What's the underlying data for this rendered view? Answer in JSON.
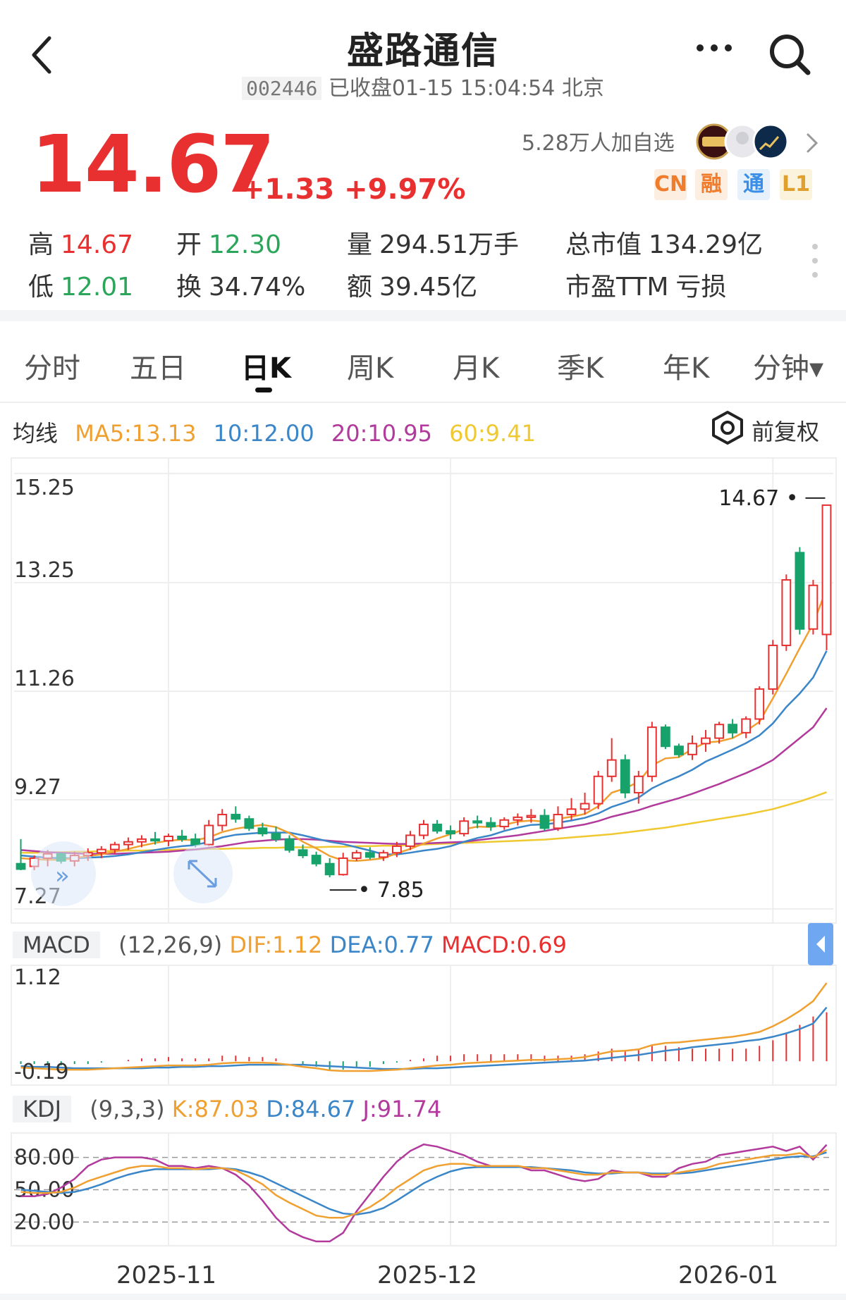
{
  "header": {
    "title": "盛路通信",
    "code": "002446",
    "status": "已收盘01-15 15:04:54 北京"
  },
  "quote": {
    "price": "14.67",
    "change": "+1.33 +9.97%",
    "watchers": "5.28万人加自选",
    "tags": [
      "CN",
      "融",
      "通",
      "L1"
    ],
    "stats": {
      "high_label": "高",
      "high": "14.67",
      "low_label": "低",
      "low": "12.01",
      "open_label": "开",
      "open": "12.30",
      "turnover_label": "换",
      "turnover": "34.74%",
      "volume_label": "量",
      "volume": "294.51万手",
      "amount_label": "额",
      "amount": "39.45亿",
      "mcap_label": "总市值",
      "mcap": "134.29亿",
      "pe_label": "市盈TTM",
      "pe": "亏损"
    }
  },
  "tabs": [
    "分时",
    "五日",
    "日K",
    "周K",
    "月K",
    "季K",
    "年K",
    "分钟▾"
  ],
  "active_tab": "日K",
  "ma": {
    "label": "均线",
    "ma5": "MA5:13.13",
    "ma10": "10:12.00",
    "ma20": "20:10.95",
    "ma60": "60:9.41",
    "adjust": "前复权"
  },
  "macd_header": {
    "label": "MACD",
    "params": "(12,26,9)",
    "dif": "DIF:1.12",
    "dea": "DEA:0.77",
    "macd": "MACD:0.69"
  },
  "kdj_header": {
    "label": "KDJ",
    "params": "(9,3,3)",
    "k": "K:87.03",
    "d": "D:84.67",
    "j": "J:91.74"
  },
  "colors": {
    "up": "#e93030",
    "down": "#16a26a",
    "ma5": "#f0a030",
    "ma10": "#3a86c8",
    "ma20": "#b13a9c",
    "ma60": "#f0c830",
    "dif": "#f0a030",
    "dea": "#3a86c8"
  },
  "chart_data": {
    "type": "candlestick",
    "x_labels": [
      "2025-11",
      "2025-12",
      "2026-01"
    ],
    "x_label_index": [
      11,
      32,
      56
    ],
    "price_axis": {
      "ticks": [
        "15.25",
        "13.25",
        "11.26",
        "9.27",
        "7.27"
      ],
      "ylim": [
        7.27,
        15.25
      ]
    },
    "max_marker": "14.67",
    "min_marker": "7.85",
    "ohlc": [
      [
        8.1,
        8.55,
        7.98,
        8.0
      ],
      [
        8.05,
        8.25,
        7.98,
        8.2
      ],
      [
        8.2,
        8.35,
        8.05,
        8.28
      ],
      [
        8.28,
        8.3,
        8.1,
        8.15
      ],
      [
        8.15,
        8.32,
        8.05,
        8.25
      ],
      [
        8.25,
        8.38,
        8.15,
        8.3
      ],
      [
        8.3,
        8.42,
        8.2,
        8.36
      ],
      [
        8.36,
        8.5,
        8.28,
        8.45
      ],
      [
        8.45,
        8.58,
        8.35,
        8.5
      ],
      [
        8.5,
        8.62,
        8.4,
        8.55
      ],
      [
        8.55,
        8.68,
        8.45,
        8.52
      ],
      [
        8.52,
        8.65,
        8.42,
        8.6
      ],
      [
        8.6,
        8.72,
        8.5,
        8.55
      ],
      [
        8.55,
        8.65,
        8.4,
        8.45
      ],
      [
        8.45,
        8.9,
        8.42,
        8.8
      ],
      [
        8.8,
        9.1,
        8.7,
        9.0
      ],
      [
        9.0,
        9.15,
        8.85,
        8.92
      ],
      [
        8.92,
        8.98,
        8.7,
        8.75
      ],
      [
        8.75,
        8.85,
        8.6,
        8.65
      ],
      [
        8.65,
        8.78,
        8.5,
        8.55
      ],
      [
        8.55,
        8.62,
        8.3,
        8.35
      ],
      [
        8.35,
        8.45,
        8.2,
        8.25
      ],
      [
        8.25,
        8.32,
        8.05,
        8.1
      ],
      [
        8.1,
        8.2,
        7.85,
        7.9
      ],
      [
        7.9,
        8.3,
        7.88,
        8.2
      ],
      [
        8.2,
        8.35,
        8.15,
        8.3
      ],
      [
        8.3,
        8.4,
        8.18,
        8.22
      ],
      [
        8.22,
        8.35,
        8.15,
        8.3
      ],
      [
        8.3,
        8.5,
        8.22,
        8.42
      ],
      [
        8.42,
        8.7,
        8.35,
        8.62
      ],
      [
        8.62,
        8.9,
        8.55,
        8.82
      ],
      [
        8.82,
        8.9,
        8.65,
        8.7
      ],
      [
        8.7,
        8.8,
        8.55,
        8.65
      ],
      [
        8.65,
        8.95,
        8.6,
        8.88
      ],
      [
        8.88,
        8.98,
        8.75,
        8.85
      ],
      [
        8.85,
        8.95,
        8.7,
        8.78
      ],
      [
        8.78,
        8.95,
        8.72,
        8.9
      ],
      [
        8.9,
        9.02,
        8.8,
        8.95
      ],
      [
        8.95,
        9.1,
        8.85,
        8.98
      ],
      [
        8.98,
        9.1,
        8.7,
        8.75
      ],
      [
        8.75,
        9.15,
        8.7,
        9.0
      ],
      [
        9.0,
        9.3,
        8.9,
        9.1
      ],
      [
        9.1,
        9.4,
        9.0,
        9.2
      ],
      [
        9.2,
        9.8,
        9.1,
        9.7
      ],
      [
        9.7,
        10.4,
        9.6,
        10.0
      ],
      [
        10.0,
        10.1,
        9.3,
        9.4
      ],
      [
        9.4,
        9.8,
        9.2,
        9.7
      ],
      [
        9.7,
        10.7,
        9.6,
        10.6
      ],
      [
        10.6,
        10.65,
        10.2,
        10.25
      ],
      [
        10.25,
        10.3,
        10.05,
        10.1
      ],
      [
        10.1,
        10.45,
        10.0,
        10.3
      ],
      [
        10.3,
        10.55,
        10.15,
        10.4
      ],
      [
        10.4,
        10.7,
        10.3,
        10.65
      ],
      [
        10.65,
        10.75,
        10.4,
        10.5
      ],
      [
        10.5,
        10.8,
        10.4,
        10.75
      ],
      [
        10.75,
        11.35,
        10.65,
        11.3
      ],
      [
        11.3,
        12.2,
        11.2,
        12.1
      ],
      [
        12.1,
        13.4,
        12.0,
        13.3
      ],
      [
        13.8,
        13.9,
        12.3,
        12.4
      ],
      [
        12.4,
        13.3,
        12.3,
        13.2
      ],
      [
        12.3,
        14.67,
        12.01,
        14.67
      ]
    ],
    "ma5": [
      8.2,
      8.18,
      8.17,
      8.17,
      8.2,
      8.24,
      8.27,
      8.32,
      8.37,
      8.43,
      8.48,
      8.52,
      8.54,
      8.53,
      8.58,
      8.68,
      8.74,
      8.78,
      8.81,
      8.77,
      8.66,
      8.5,
      8.38,
      8.24,
      8.16,
      8.15,
      8.17,
      8.2,
      8.29,
      8.37,
      8.47,
      8.56,
      8.64,
      8.73,
      8.78,
      8.77,
      8.81,
      8.87,
      8.89,
      8.87,
      8.92,
      8.96,
      9.01,
      9.15,
      9.4,
      9.48,
      9.6,
      9.9,
      10.03,
      10.05,
      10.2,
      10.32,
      10.34,
      10.4,
      10.53,
      10.7,
      11.13,
      11.58,
      12.05,
      12.5,
      13.13
    ],
    "ma10": [
      8.25,
      8.23,
      8.21,
      8.2,
      8.2,
      8.21,
      8.22,
      8.24,
      8.27,
      8.31,
      8.35,
      8.39,
      8.42,
      8.44,
      8.5,
      8.58,
      8.63,
      8.65,
      8.67,
      8.67,
      8.67,
      8.62,
      8.56,
      8.5,
      8.46,
      8.4,
      8.34,
      8.27,
      8.27,
      8.3,
      8.34,
      8.37,
      8.42,
      8.5,
      8.57,
      8.62,
      8.7,
      8.76,
      8.81,
      8.82,
      8.85,
      8.89,
      8.94,
      9.02,
      9.14,
      9.22,
      9.31,
      9.48,
      9.6,
      9.7,
      9.82,
      9.97,
      10.08,
      10.19,
      10.31,
      10.45,
      10.67,
      10.97,
      11.22,
      11.51,
      12.0
    ],
    "ma20": [
      8.35,
      8.33,
      8.31,
      8.3,
      8.29,
      8.28,
      8.28,
      8.28,
      8.29,
      8.3,
      8.31,
      8.32,
      8.34,
      8.36,
      8.39,
      8.42,
      8.46,
      8.5,
      8.52,
      8.54,
      8.55,
      8.55,
      8.54,
      8.52,
      8.5,
      8.49,
      8.48,
      8.47,
      8.46,
      8.46,
      8.47,
      8.48,
      8.49,
      8.5,
      8.53,
      8.56,
      8.59,
      8.62,
      8.66,
      8.7,
      8.74,
      8.78,
      8.82,
      8.88,
      8.96,
      9.02,
      9.08,
      9.16,
      9.23,
      9.3,
      9.38,
      9.47,
      9.56,
      9.66,
      9.76,
      9.87,
      10.0,
      10.2,
      10.4,
      10.6,
      10.95
    ],
    "ma60": [
      8.3,
      8.3,
      8.31,
      8.31,
      8.32,
      8.32,
      8.33,
      8.33,
      8.34,
      8.34,
      8.35,
      8.35,
      8.36,
      8.36,
      8.37,
      8.37,
      8.38,
      8.38,
      8.39,
      8.39,
      8.4,
      8.4,
      8.4,
      8.41,
      8.41,
      8.42,
      8.42,
      8.43,
      8.43,
      8.44,
      8.45,
      8.46,
      8.47,
      8.48,
      8.49,
      8.5,
      8.51,
      8.52,
      8.53,
      8.54,
      8.56,
      8.58,
      8.6,
      8.62,
      8.64,
      8.67,
      8.7,
      8.73,
      8.76,
      8.8,
      8.84,
      8.88,
      8.92,
      8.96,
      9.0,
      9.05,
      9.1,
      9.17,
      9.24,
      9.32,
      9.41
    ],
    "macd_axis": {
      "ticks": [
        "1.12",
        "-0.19"
      ],
      "ylim": [
        -0.19,
        1.12
      ]
    },
    "dif": [
      -0.09,
      -0.1,
      -0.11,
      -0.12,
      -0.12,
      -0.12,
      -0.11,
      -0.1,
      -0.09,
      -0.08,
      -0.07,
      -0.06,
      -0.06,
      -0.06,
      -0.05,
      -0.03,
      -0.02,
      -0.02,
      -0.02,
      -0.03,
      -0.05,
      -0.08,
      -0.1,
      -0.13,
      -0.14,
      -0.14,
      -0.14,
      -0.13,
      -0.12,
      -0.1,
      -0.08,
      -0.06,
      -0.05,
      -0.03,
      -0.02,
      -0.01,
      0.0,
      0.01,
      0.02,
      0.02,
      0.03,
      0.04,
      0.06,
      0.1,
      0.14,
      0.15,
      0.17,
      0.23,
      0.26,
      0.27,
      0.29,
      0.31,
      0.33,
      0.35,
      0.38,
      0.42,
      0.5,
      0.6,
      0.72,
      0.86,
      1.12
    ],
    "dea": [
      -0.07,
      -0.08,
      -0.08,
      -0.09,
      -0.1,
      -0.1,
      -0.1,
      -0.1,
      -0.1,
      -0.1,
      -0.09,
      -0.09,
      -0.08,
      -0.08,
      -0.07,
      -0.07,
      -0.06,
      -0.05,
      -0.05,
      -0.05,
      -0.05,
      -0.05,
      -0.06,
      -0.07,
      -0.08,
      -0.09,
      -0.1,
      -0.11,
      -0.11,
      -0.11,
      -0.1,
      -0.1,
      -0.09,
      -0.08,
      -0.07,
      -0.06,
      -0.05,
      -0.04,
      -0.03,
      -0.02,
      -0.01,
      0.0,
      0.01,
      0.03,
      0.05,
      0.07,
      0.09,
      0.12,
      0.15,
      0.17,
      0.2,
      0.22,
      0.24,
      0.26,
      0.29,
      0.31,
      0.35,
      0.4,
      0.46,
      0.54,
      0.77
    ],
    "kdj_axis": {
      "ticks": [
        "80.00",
        "50.00",
        "20.00"
      ],
      "ylim": [
        0,
        100
      ]
    },
    "k": [
      48,
      47,
      47,
      48,
      52,
      58,
      62,
      66,
      70,
      72,
      72,
      70,
      70,
      69,
      70,
      70,
      68,
      62,
      55,
      45,
      38,
      32,
      26,
      24,
      24,
      28,
      34,
      42,
      52,
      60,
      68,
      72,
      74,
      74,
      72,
      72,
      72,
      72,
      70,
      70,
      68,
      66,
      64,
      64,
      66,
      66,
      66,
      64,
      64,
      66,
      68,
      70,
      74,
      76,
      78,
      80,
      82,
      82,
      84,
      80,
      87.03
    ],
    "d": [
      50,
      49,
      48,
      47,
      48,
      51,
      55,
      60,
      64,
      67,
      69,
      69,
      69,
      69,
      69,
      70,
      69,
      66,
      62,
      56,
      50,
      44,
      38,
      32,
      28,
      27,
      29,
      33,
      40,
      48,
      56,
      62,
      67,
      70,
      71,
      71,
      71,
      71,
      71,
      70,
      69,
      68,
      66,
      65,
      65,
      66,
      66,
      65,
      65,
      65,
      66,
      68,
      70,
      72,
      74,
      76,
      78,
      80,
      81,
      81,
      84.67
    ],
    "j": [
      44,
      44,
      46,
      52,
      60,
      72,
      78,
      80,
      80,
      80,
      78,
      72,
      72,
      70,
      72,
      70,
      64,
      54,
      40,
      24,
      12,
      6,
      2,
      2,
      10,
      30,
      46,
      62,
      76,
      86,
      92,
      90,
      86,
      82,
      76,
      72,
      72,
      72,
      68,
      68,
      64,
      60,
      58,
      60,
      68,
      66,
      66,
      62,
      62,
      70,
      74,
      76,
      82,
      84,
      86,
      88,
      90,
      86,
      90,
      78,
      91.74
    ]
  }
}
